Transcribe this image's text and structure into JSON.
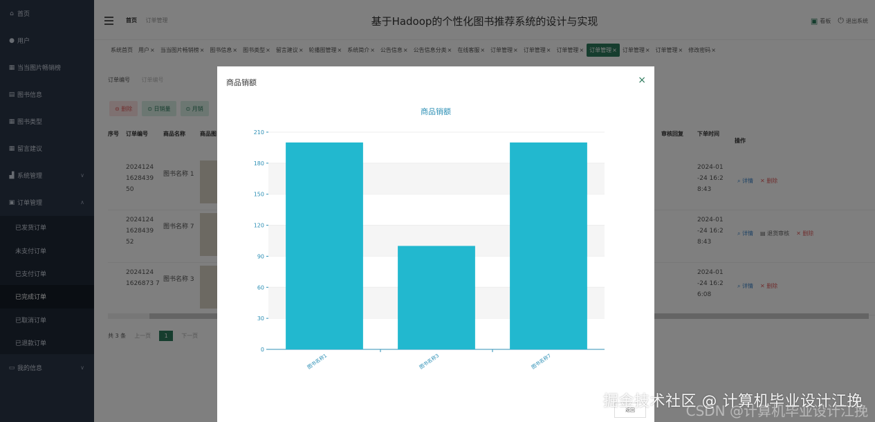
{
  "sidebar": {
    "items": [
      {
        "label": "首页",
        "icon": "home-icon"
      },
      {
        "label": "用户",
        "icon": "user-icon"
      },
      {
        "label": "当当图片畅销榜",
        "icon": "grid-icon"
      },
      {
        "label": "图书信息",
        "icon": "book-icon"
      },
      {
        "label": "图书类型",
        "icon": "grid-icon"
      },
      {
        "label": "留言建议",
        "icon": "grid-icon"
      },
      {
        "label": "系统管理",
        "icon": "chart-icon",
        "chevron": "∨"
      },
      {
        "label": "订单管理",
        "icon": "cart-icon",
        "chevron": "∧"
      }
    ],
    "order_sub": [
      "已发货订单",
      "未支付订单",
      "已支付订单",
      "已完成订单",
      "已取消订单",
      "已退款订单"
    ],
    "active_sub": "已完成订单",
    "bottom_item": {
      "label": "我的信息",
      "icon": "card-icon",
      "chevron": "∨"
    }
  },
  "header": {
    "crumb_current": "首页",
    "crumb_page": "订单管理",
    "title": "基于Hadoop的个性化图书推荐系统的设计与实现",
    "right_link_1": "看板",
    "right_link_2": "退出系统"
  },
  "tabs": [
    "系统首页",
    "用户",
    "当当图片畅销榜",
    "图书信息",
    "图书类型",
    "留言建议",
    "轮播图管理",
    "系统简介",
    "公告信息",
    "公告信息分类",
    "在线客服",
    "订单管理",
    "订单管理",
    "订单管理",
    "订单管理",
    "订单管理",
    "订单管理",
    "修改密码"
  ],
  "active_tab_index": 14,
  "content": {
    "search_label": "订单编号",
    "search_placeholder": "订单编号",
    "buttons": {
      "delete": "删除",
      "daily": "日销量",
      "monthly": "月销"
    },
    "columns": {
      "idx": "序号",
      "order_no": "订单编号",
      "name": "商品名称",
      "image": "商品图",
      "review": "审核回复",
      "time": "下单时间",
      "ops": "操作"
    },
    "rows": [
      {
        "order_no": "2024124 1628439 50",
        "name": "图书名称 1",
        "time": "2024-01 -24 16:2 8:43",
        "ops": [
          "详情",
          "删除"
        ]
      },
      {
        "order_no": "2024124 1628439 52",
        "name": "图书名称 7",
        "time": "2024-01 -24 16:2 8:43",
        "ops": [
          "详情",
          "退货审核",
          "删除"
        ]
      },
      {
        "order_no": "2024124 1626873 7",
        "name": "图书名称 3",
        "time": "2024-01 -24 16:2 6:08",
        "ops": [
          "详情",
          "删除"
        ]
      }
    ],
    "pager": {
      "total": "共 3 条",
      "prev": "上一页",
      "current": "1",
      "next": "下一页"
    }
  },
  "modal": {
    "title": "商品销额",
    "close": "×",
    "footer_button": "返回"
  },
  "chart_data": {
    "type": "bar",
    "title": "商品销额",
    "categories": [
      "图书名称1",
      "图书名称3",
      "图书名称7"
    ],
    "values": [
      200,
      100,
      200
    ],
    "ylim": [
      0,
      210
    ],
    "yticks": [
      0,
      30,
      60,
      90,
      120,
      150,
      180,
      210
    ],
    "bar_color": "#22b8cf",
    "grid": "horizontal bands"
  },
  "watermark": "掘金技术社区 @ 计算机毕业设计江挽",
  "watermark_faint": "CSDN @计算机毕业设计江挽",
  "colors": {
    "accent": "#2c7a5c",
    "sidebar": "#2b3648",
    "danger": "#e06060"
  }
}
